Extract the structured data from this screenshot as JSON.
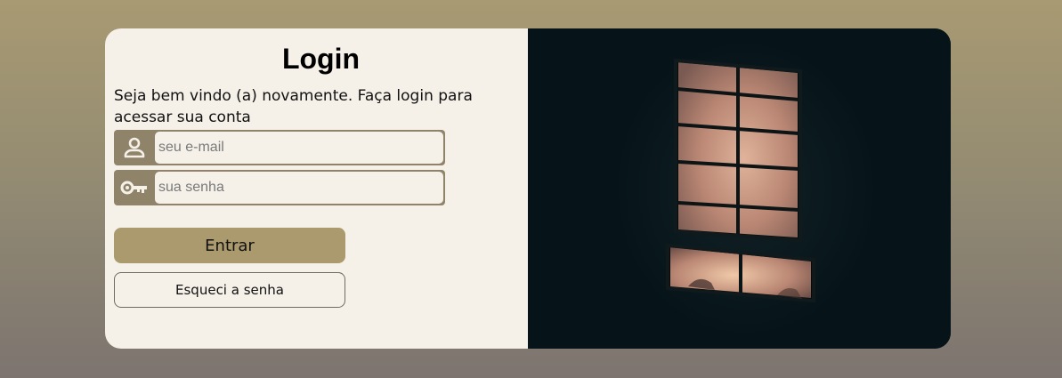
{
  "login": {
    "title": "Login",
    "subtitle": "Seja bem vindo (a) novamente. Faça login para acessar sua conta",
    "email": {
      "placeholder": "seu e-mail",
      "icon": "user-icon"
    },
    "password": {
      "placeholder": "sua senha",
      "icon": "key-icon"
    },
    "submit_label": "Entrar",
    "forgot_label": "Esqueci a senha"
  },
  "colors": {
    "card_left_bg": "#f5f0e8",
    "field_accent": "#8f8369",
    "button_primary": "#ab9a6d",
    "photo_bg": "#06141a",
    "window_glow": "#c89b84"
  },
  "photo": {
    "subject": "lit-window-at-night"
  }
}
